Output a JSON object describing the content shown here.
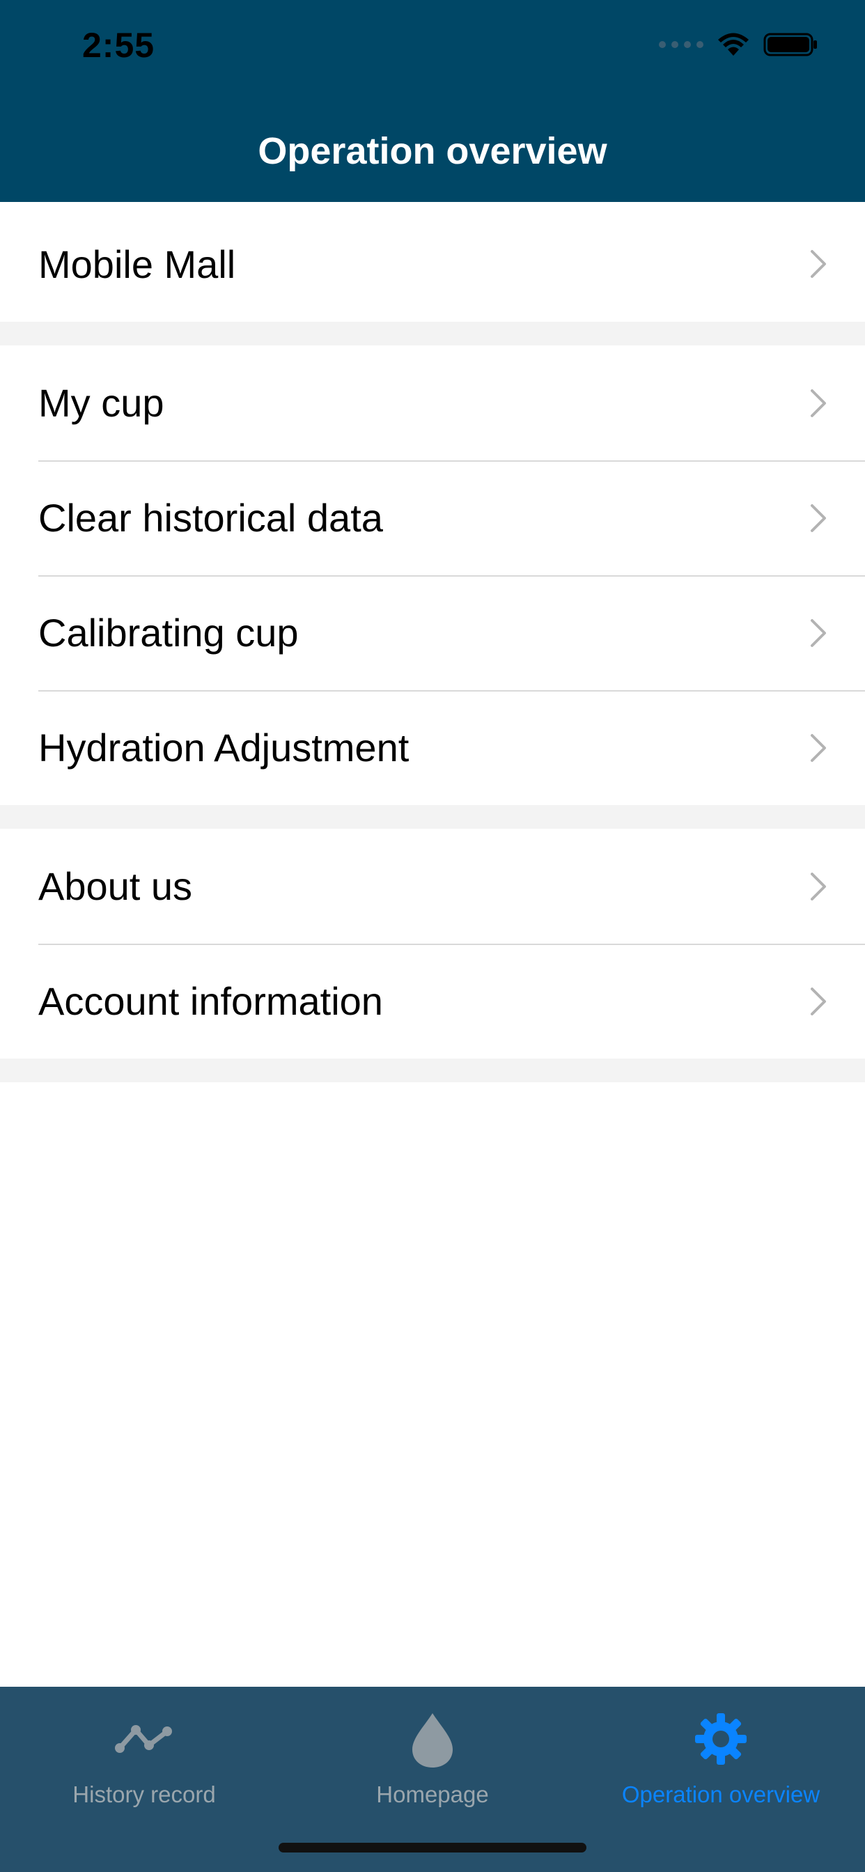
{
  "status_bar": {
    "time": "2:55"
  },
  "header": {
    "title": "Operation overview"
  },
  "menu": {
    "group1": [
      {
        "label": "Mobile Mall",
        "icon": "chevron-right-icon"
      }
    ],
    "group2": [
      {
        "label": "My cup",
        "icon": "chevron-right-icon"
      },
      {
        "label": "Clear historical data",
        "icon": "chevron-right-icon"
      },
      {
        "label": "Calibrating cup",
        "icon": "chevron-right-icon"
      },
      {
        "label": "Hydration Adjustment",
        "icon": "chevron-right-icon"
      }
    ],
    "group3": [
      {
        "label": "About us",
        "icon": "chevron-right-icon"
      },
      {
        "label": "Account information",
        "icon": "chevron-right-icon"
      }
    ]
  },
  "tabbar": {
    "tabs": [
      {
        "label": "History record",
        "icon": "line-chart-icon",
        "active": false
      },
      {
        "label": "Homepage",
        "icon": "water-drop-icon",
        "active": false
      },
      {
        "label": "Operation overview",
        "icon": "gear-icon",
        "active": true
      }
    ]
  },
  "colors": {
    "header_bg": "#004766",
    "tabbar_bg": "#26506b",
    "active_tab": "#0a84ff",
    "inactive_tab": "#9aa6ad"
  }
}
